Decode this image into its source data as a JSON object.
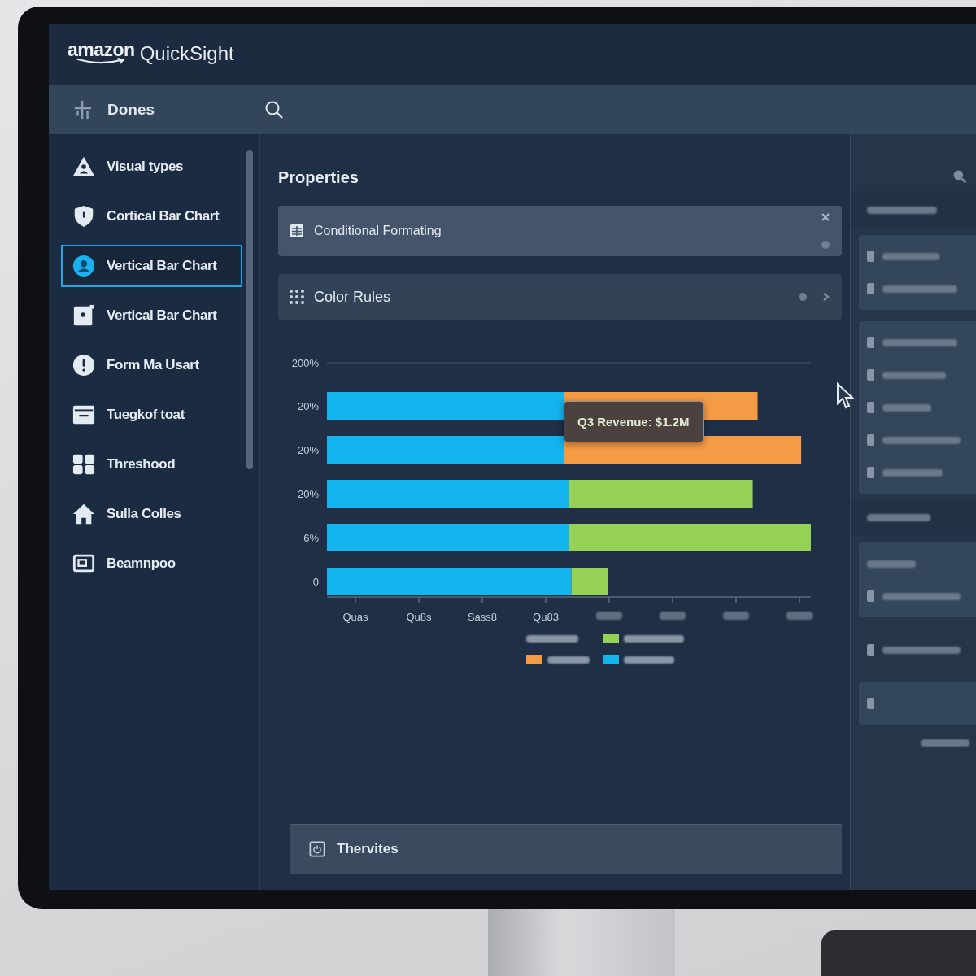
{
  "logo": {
    "brand": "amazon",
    "product": "QuickSight"
  },
  "toolbar": {
    "title": "Dones"
  },
  "sidebar": {
    "items": [
      {
        "label": "Visual types",
        "selected": false
      },
      {
        "label": "Cortical Bar Chart",
        "selected": false
      },
      {
        "label": "Vertical Bar Chart",
        "selected": true
      },
      {
        "label": "Vertical Bar Chart",
        "selected": false
      },
      {
        "label": "Form Ma Usart",
        "selected": false
      },
      {
        "label": "Tuegkof toat",
        "selected": false
      },
      {
        "label": "Threshood",
        "selected": false
      },
      {
        "label": "Sulla Colles",
        "selected": false
      },
      {
        "label": "Beamnpoo",
        "selected": false
      }
    ]
  },
  "properties": {
    "title": "Properties",
    "sections": [
      {
        "label": "Conditional Formating"
      },
      {
        "label": "Color Rules"
      }
    ]
  },
  "chart": {
    "y_labels": [
      "200%",
      "20%",
      "20%",
      "20%",
      "6%",
      "0"
    ],
    "x_labels": [
      {
        "kind": "text",
        "text": "Quas"
      },
      {
        "kind": "text",
        "text": "Qu8s"
      },
      {
        "kind": "text",
        "text": "Sass8"
      },
      {
        "kind": "text",
        "text": "Qu83"
      },
      {
        "kind": "blurred"
      },
      {
        "kind": "blurred"
      },
      {
        "kind": "blurred"
      },
      {
        "kind": "blurred"
      }
    ],
    "bars": [
      {
        "color": "#f59a45"
      },
      {
        "color": "#f59a45"
      },
      {
        "color": "#95d154"
      },
      {
        "color": "#95d154"
      },
      {
        "color": "#95d154"
      }
    ],
    "tooltip": "Q3 Revenue: $1.2M",
    "legend": [
      {
        "kind": "text"
      },
      {
        "kind": "swatch",
        "color": "#95d154"
      },
      {
        "kind": "swatch",
        "color": "#f59a45"
      },
      {
        "kind": "swatch",
        "color": "#14b4ef"
      }
    ]
  },
  "footer": {
    "label": "Thervites"
  },
  "right_panel": {
    "groups": [
      {
        "kind": "heading"
      },
      {
        "kind": "card",
        "items": [
          {
            "kind": "row"
          },
          {
            "kind": "row"
          }
        ]
      },
      {
        "kind": "card",
        "items": [
          {
            "kind": "row"
          },
          {
            "kind": "row"
          },
          {
            "kind": "row"
          },
          {
            "kind": "row"
          },
          {
            "kind": "row"
          }
        ]
      },
      {
        "kind": "heading"
      },
      {
        "kind": "card",
        "items": [
          {
            "kind": "line"
          },
          {
            "kind": "row"
          }
        ]
      },
      {
        "kind": "plain",
        "items": [
          {
            "kind": "row"
          }
        ]
      },
      {
        "kind": "card",
        "items": [
          {
            "kind": "icon"
          }
        ]
      },
      {
        "kind": "footer"
      }
    ]
  }
}
